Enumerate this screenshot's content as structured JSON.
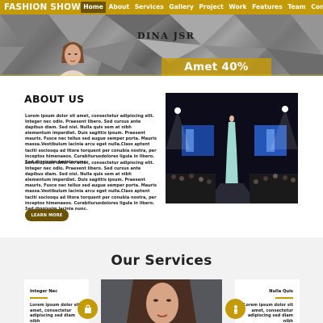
{
  "nav": {
    "brand": "FASHION SHOW",
    "items": [
      {
        "label": "Home",
        "active": true
      },
      {
        "label": "About",
        "active": false
      },
      {
        "label": "Services",
        "active": false
      },
      {
        "label": "Gallery",
        "active": false
      },
      {
        "label": "Project",
        "active": false
      },
      {
        "label": "Work",
        "active": false
      },
      {
        "label": "Features",
        "active": false
      },
      {
        "label": "Team",
        "active": false
      },
      {
        "label": "Contact",
        "active": false
      }
    ]
  },
  "hero": {
    "title": "DINA JSR",
    "promo": "Amet 40%"
  },
  "about": {
    "title": "ABOUT US",
    "paragraph1": "Lorem ipsum dolor sit amet, consectetur adipiscing elit. Integer nec odio. Praesent libero. Sed cursus ante dapibus diam. Sed nisi. Nulla quis sem at nibh elementum imperdiet. Duis sagittis ipsum. Praesent mauris. Fusce nec tellus sed augue semper porta. Mauris massa.Vestibulum lacinia arcu eget nulla.Class aptent taciti sociosqu ad litora torquent per conubia nostra, per inceptos himenaeos. Curabiturusdolores ligula in libero. Sed dignissim lacinia nunc.",
    "paragraph2": "Lorem ipsum dolor sit amet, consectetur adipiscing elit. Integer nec odio. Praesent libero. Sed cursus ante dapibus diam. Sed nisi. Nulla quis sem at nibh elementum imperdiet. Duis sagittis ipsum. Praesent mauris. Fusce nec tellus sed augue semper porta. Mauris massa.Vestibulum lacinia arcu eget nulla.Class aptent taciti sociosqu ad litora torquent per conubia nostra, per inceptos himenaeos. Curabiturusdolores ligula in libero. Sed dignissim lacinia nunc.",
    "button": "LEARN MORE"
  },
  "services": {
    "title": "Our Services",
    "left": {
      "name": "Integer Nec",
      "text": "Lorem ipsum dolor sit amet, consectetur adipiscing sed diam nibh",
      "icon": "shopping-bag-icon"
    },
    "right": {
      "name": "Nulla Quis",
      "text": "Lorem ipsum dolor sit amet, consectetur adipiscing sed diam nibh",
      "icon": "person-icon"
    }
  },
  "colors": {
    "brand": "#c49a06",
    "brand_dark": "#6b5304",
    "services_bg": "#f2f2f2"
  }
}
